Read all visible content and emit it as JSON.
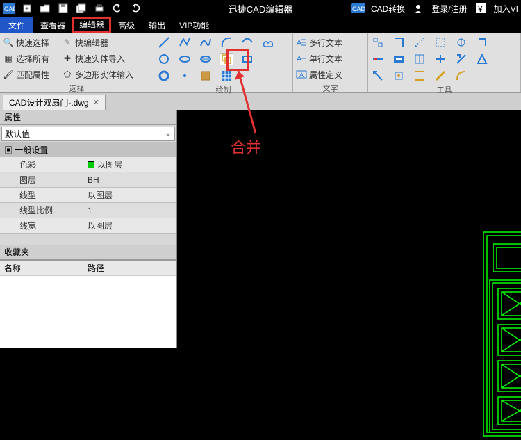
{
  "titlebar": {
    "app_title": "迅捷CAD编辑器",
    "right": {
      "convert": "CAD转换",
      "login": "登录/注册",
      "join": "加入VI"
    }
  },
  "menu": {
    "file": "文件",
    "items": [
      "查看器",
      "编辑器",
      "高级",
      "输出",
      "VIP功能"
    ]
  },
  "ribbon": {
    "select": {
      "quick_select": "快速选择",
      "quick_editor": "快编辑器",
      "select_all": "选择所有",
      "quick_entity_import": "快速实体导入",
      "match_props": "匹配属性",
      "poly_entity_input": "多边形实体输入",
      "label": "选择"
    },
    "draw_label": "绘制",
    "text": {
      "mtext": "多行文本",
      "stext": "单行文本",
      "attr_def": "属性定义",
      "label": "文字"
    },
    "tools_label": "工具"
  },
  "doc_tab": {
    "name": "CAD设计双扇门-.dwg"
  },
  "props": {
    "title": "属性",
    "default": "默认值",
    "section": "一般设置",
    "rows": [
      {
        "k": "色彩",
        "v": "以图层",
        "color": true
      },
      {
        "k": "图层",
        "v": "BH"
      },
      {
        "k": "线型",
        "v": "以图层"
      },
      {
        "k": "线型比例",
        "v": "1"
      },
      {
        "k": "线宽",
        "v": "以图层"
      }
    ]
  },
  "fav": {
    "title": "收藏夹",
    "col1": "名称",
    "col2": "路径"
  },
  "annotation": "合并"
}
